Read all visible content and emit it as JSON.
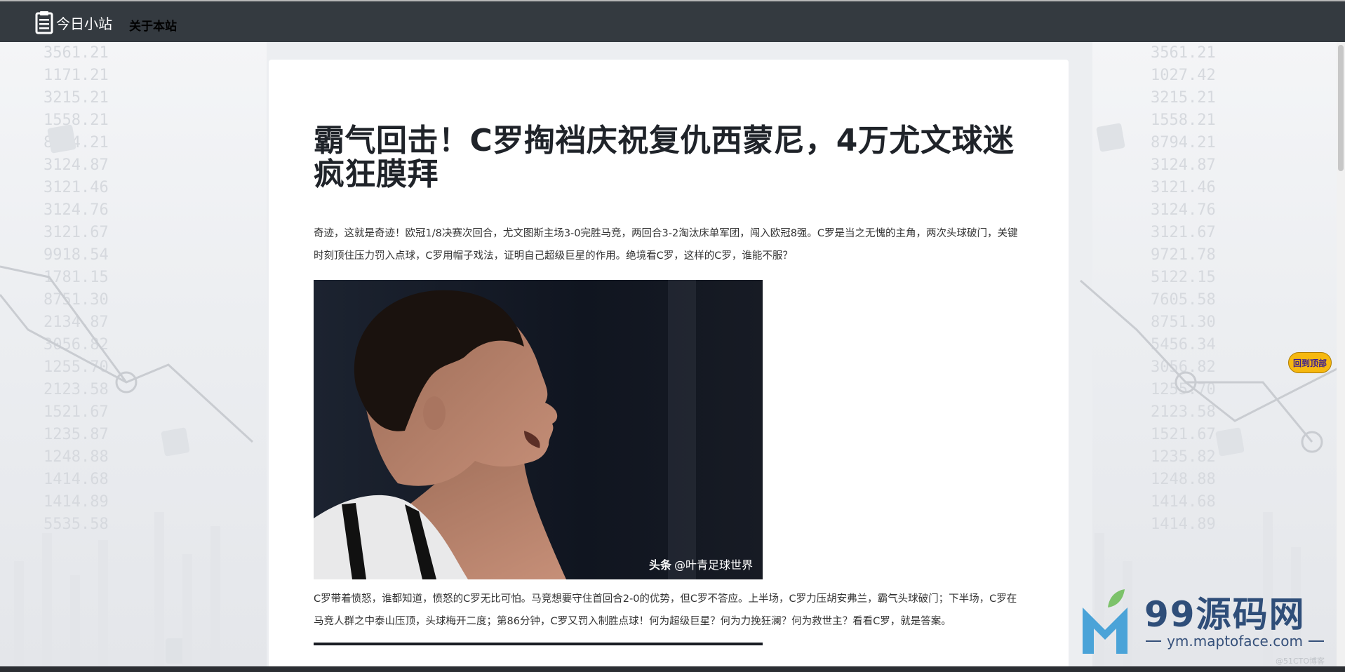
{
  "navbar": {
    "brand_label": "今日小站",
    "about_link": "关于本站"
  },
  "article": {
    "title": "霸气回击！C罗掏裆庆祝复仇西蒙尼，4万尤文球迷疯狂膜拜",
    "paragraph_1": "奇迹，这就是奇迹！欧冠1/8决赛次回合，尤文图斯主场3-0完胜马竞，两回合3-2淘汰床单军团，闯入欧冠8强。C罗是当之无愧的主角，两次头球破门，关键时刻顶住压力罚入点球，C罗用帽子戏法，证明自己超级巨星的作用。绝境看C罗，这样的C罗，谁能不服？",
    "image_caption_brand": "头条",
    "image_caption_author": "@叶青足球世界",
    "paragraph_2": "C罗带着愤怒，谁都知道，愤怒的C罗无比可怕。马竞想要守住首回合2-0的优势，但C罗不答应。上半场，C罗力压胡安弗兰，霸气头球破门；下半场，C罗在马竞人群之中泰山压顶，头球梅开二度；第86分钟，C罗又罚入制胜点球！何为超级巨星？何为力挽狂澜？何为救世主？看看C罗，就是答案。"
  },
  "floating": {
    "back_to_top": "回到顶部"
  },
  "logo": {
    "title": "99源码网",
    "subtitle": "ym.maptoface.com"
  },
  "credit": "@51CTO博客",
  "colors": {
    "navbar_bg": "#343a40",
    "back_to_top_bg": "#f6b80f",
    "logo_blue": "#2f4e79"
  }
}
